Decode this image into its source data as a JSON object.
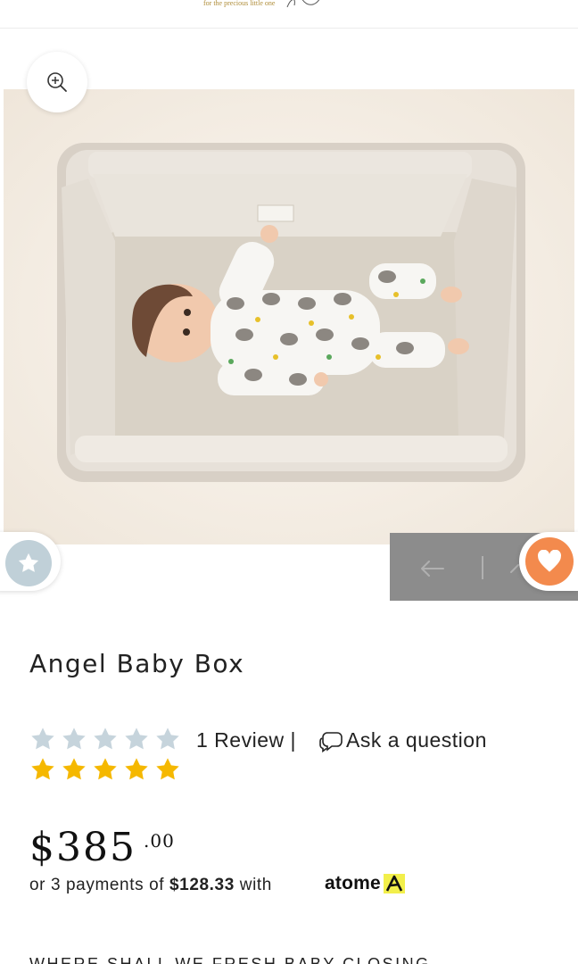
{
  "header": {
    "tagline": "for the precious little one"
  },
  "gallery": {
    "zoom_icon": "zoom-in-icon",
    "product_image_alt": "baby-in-box-photo"
  },
  "product": {
    "title": "Angel Baby Box",
    "rating": {
      "stars_filled": 5,
      "stars_total": 5,
      "review_count_label": "1 Review |",
      "ask_label": "Ask a question"
    },
    "price_main": "$385",
    "price_cents": ".00",
    "installment_prefix": "or 3 payments of ",
    "installment_amount": "$128.33",
    "installment_suffix": " with",
    "atome_label": "atome",
    "cut_off_line": "WHERE SHALL WE FRESH BABY CLOSING"
  },
  "colors": {
    "star_gold": "#f5b800",
    "star_empty": "#c6d4dc",
    "wishlist_orange": "#f38a4d",
    "share_gray": "#8c8c8c",
    "atome_yellow": "#f2ef4b"
  },
  "icons": {
    "review": "star-icon",
    "wishlist": "heart-icon",
    "ask": "chat-bubble-icon",
    "share": "share-icon"
  }
}
